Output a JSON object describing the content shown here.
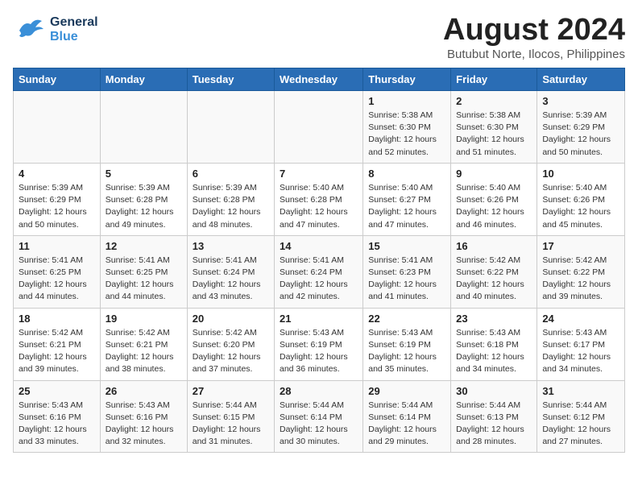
{
  "header": {
    "logo_general": "General",
    "logo_blue": "Blue",
    "month_title": "August 2024",
    "location": "Butubut Norte, Ilocos, Philippines"
  },
  "weekdays": [
    "Sunday",
    "Monday",
    "Tuesday",
    "Wednesday",
    "Thursday",
    "Friday",
    "Saturday"
  ],
  "weeks": [
    {
      "days": [
        {
          "num": "",
          "info": ""
        },
        {
          "num": "",
          "info": ""
        },
        {
          "num": "",
          "info": ""
        },
        {
          "num": "",
          "info": ""
        },
        {
          "num": "1",
          "info": "Sunrise: 5:38 AM\nSunset: 6:30 PM\nDaylight: 12 hours\nand 52 minutes."
        },
        {
          "num": "2",
          "info": "Sunrise: 5:38 AM\nSunset: 6:30 PM\nDaylight: 12 hours\nand 51 minutes."
        },
        {
          "num": "3",
          "info": "Sunrise: 5:39 AM\nSunset: 6:29 PM\nDaylight: 12 hours\nand 50 minutes."
        }
      ]
    },
    {
      "days": [
        {
          "num": "4",
          "info": "Sunrise: 5:39 AM\nSunset: 6:29 PM\nDaylight: 12 hours\nand 50 minutes."
        },
        {
          "num": "5",
          "info": "Sunrise: 5:39 AM\nSunset: 6:28 PM\nDaylight: 12 hours\nand 49 minutes."
        },
        {
          "num": "6",
          "info": "Sunrise: 5:39 AM\nSunset: 6:28 PM\nDaylight: 12 hours\nand 48 minutes."
        },
        {
          "num": "7",
          "info": "Sunrise: 5:40 AM\nSunset: 6:28 PM\nDaylight: 12 hours\nand 47 minutes."
        },
        {
          "num": "8",
          "info": "Sunrise: 5:40 AM\nSunset: 6:27 PM\nDaylight: 12 hours\nand 47 minutes."
        },
        {
          "num": "9",
          "info": "Sunrise: 5:40 AM\nSunset: 6:26 PM\nDaylight: 12 hours\nand 46 minutes."
        },
        {
          "num": "10",
          "info": "Sunrise: 5:40 AM\nSunset: 6:26 PM\nDaylight: 12 hours\nand 45 minutes."
        }
      ]
    },
    {
      "days": [
        {
          "num": "11",
          "info": "Sunrise: 5:41 AM\nSunset: 6:25 PM\nDaylight: 12 hours\nand 44 minutes."
        },
        {
          "num": "12",
          "info": "Sunrise: 5:41 AM\nSunset: 6:25 PM\nDaylight: 12 hours\nand 44 minutes."
        },
        {
          "num": "13",
          "info": "Sunrise: 5:41 AM\nSunset: 6:24 PM\nDaylight: 12 hours\nand 43 minutes."
        },
        {
          "num": "14",
          "info": "Sunrise: 5:41 AM\nSunset: 6:24 PM\nDaylight: 12 hours\nand 42 minutes."
        },
        {
          "num": "15",
          "info": "Sunrise: 5:41 AM\nSunset: 6:23 PM\nDaylight: 12 hours\nand 41 minutes."
        },
        {
          "num": "16",
          "info": "Sunrise: 5:42 AM\nSunset: 6:22 PM\nDaylight: 12 hours\nand 40 minutes."
        },
        {
          "num": "17",
          "info": "Sunrise: 5:42 AM\nSunset: 6:22 PM\nDaylight: 12 hours\nand 39 minutes."
        }
      ]
    },
    {
      "days": [
        {
          "num": "18",
          "info": "Sunrise: 5:42 AM\nSunset: 6:21 PM\nDaylight: 12 hours\nand 39 minutes."
        },
        {
          "num": "19",
          "info": "Sunrise: 5:42 AM\nSunset: 6:21 PM\nDaylight: 12 hours\nand 38 minutes."
        },
        {
          "num": "20",
          "info": "Sunrise: 5:42 AM\nSunset: 6:20 PM\nDaylight: 12 hours\nand 37 minutes."
        },
        {
          "num": "21",
          "info": "Sunrise: 5:43 AM\nSunset: 6:19 PM\nDaylight: 12 hours\nand 36 minutes."
        },
        {
          "num": "22",
          "info": "Sunrise: 5:43 AM\nSunset: 6:19 PM\nDaylight: 12 hours\nand 35 minutes."
        },
        {
          "num": "23",
          "info": "Sunrise: 5:43 AM\nSunset: 6:18 PM\nDaylight: 12 hours\nand 34 minutes."
        },
        {
          "num": "24",
          "info": "Sunrise: 5:43 AM\nSunset: 6:17 PM\nDaylight: 12 hours\nand 34 minutes."
        }
      ]
    },
    {
      "days": [
        {
          "num": "25",
          "info": "Sunrise: 5:43 AM\nSunset: 6:16 PM\nDaylight: 12 hours\nand 33 minutes."
        },
        {
          "num": "26",
          "info": "Sunrise: 5:43 AM\nSunset: 6:16 PM\nDaylight: 12 hours\nand 32 minutes."
        },
        {
          "num": "27",
          "info": "Sunrise: 5:44 AM\nSunset: 6:15 PM\nDaylight: 12 hours\nand 31 minutes."
        },
        {
          "num": "28",
          "info": "Sunrise: 5:44 AM\nSunset: 6:14 PM\nDaylight: 12 hours\nand 30 minutes."
        },
        {
          "num": "29",
          "info": "Sunrise: 5:44 AM\nSunset: 6:14 PM\nDaylight: 12 hours\nand 29 minutes."
        },
        {
          "num": "30",
          "info": "Sunrise: 5:44 AM\nSunset: 6:13 PM\nDaylight: 12 hours\nand 28 minutes."
        },
        {
          "num": "31",
          "info": "Sunrise: 5:44 AM\nSunset: 6:12 PM\nDaylight: 12 hours\nand 27 minutes."
        }
      ]
    }
  ]
}
